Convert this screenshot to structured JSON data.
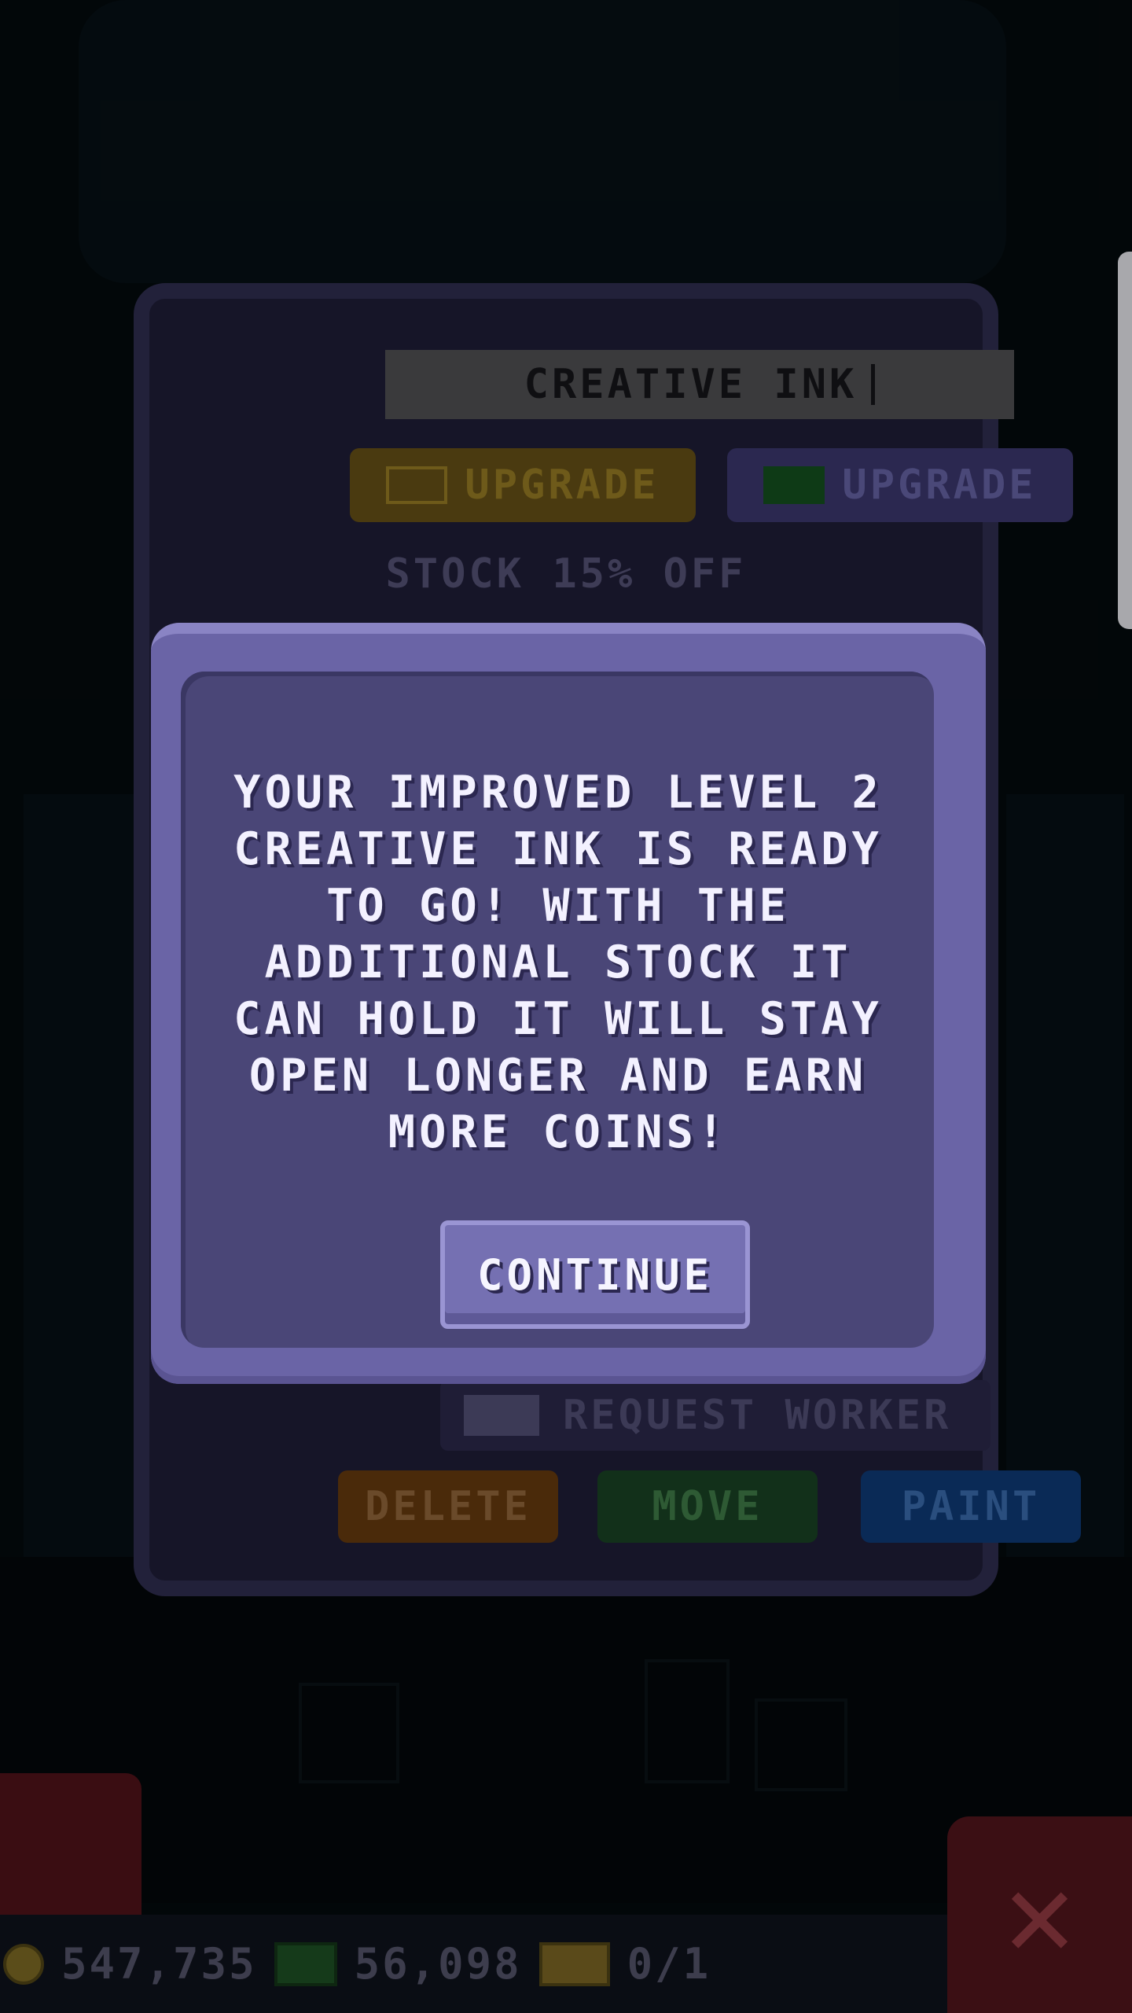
{
  "shop": {
    "name": "CREATIVE INK",
    "upgrade_gold_label": "UPGRADE",
    "upgrade_bux_label": "UPGRADE",
    "stock_discount": "STOCK 15% OFF",
    "request_worker_label": "REQUEST WORKER",
    "delete_label": "DELETE",
    "move_label": "MOVE",
    "paint_label": "PAINT"
  },
  "dialog": {
    "message": "YOUR IMPROVED LEVEL 2 CREATIVE INK IS READY TO GO! WITH THE ADDITIONAL STOCK IT CAN HOLD IT WILL STAY OPEN LONGER AND EARN MORE COINS!",
    "continue_label": "CONTINUE"
  },
  "hud": {
    "coins": "547,735",
    "bux": "56,098",
    "tickets": "0/1"
  },
  "icons": {
    "coin": "coin-icon",
    "bux": "bux-icon",
    "ticket": "ticket-icon",
    "close": "close-icon"
  }
}
